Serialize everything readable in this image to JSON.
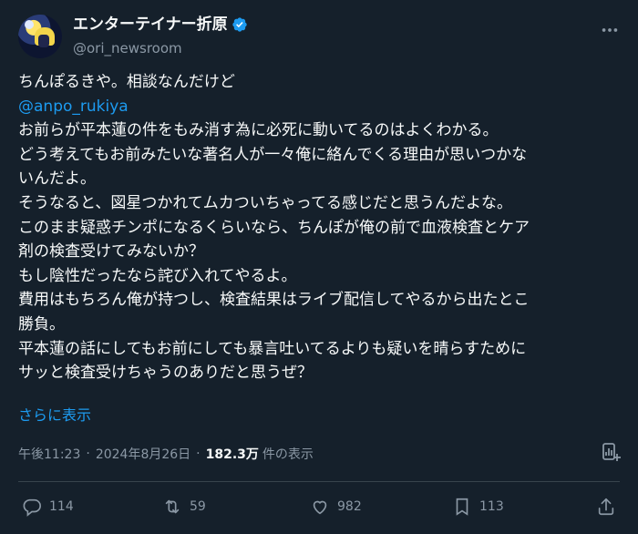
{
  "author": {
    "display_name": "エンターテイナー折原",
    "handle": "@ori_newsroom"
  },
  "tweet": {
    "lines": [
      "ちんぽるきや。相談なんだけど",
      "@anpo_rukiya",
      "お前らが平本蓮の件をもみ消す為に必死に動いてるのはよくわかる。",
      "どう考えてもお前みたいな著名人が一々俺に絡んでくる理由が思いつかな",
      "いんだよ。",
      "そうなると、図星つかれてムカついちゃってる感じだと思うんだよな。",
      "このまま疑惑チンポになるくらいなら、ちんぽが俺の前で血液検査とケア",
      "剤の検査受けてみないか？",
      "もし陰性だったなら詫び入れてやるよ。",
      "費用はもちろん俺が持つし、検査結果はライブ配信してやるから出たとこ",
      "勝負。",
      "平本蓮の話にしてもお前にしても暴言吐いてるよりも疑いを晴らすために",
      "サッと検査受けちゃうのありだと思うぜ？"
    ],
    "show_more": "さらに表示"
  },
  "meta": {
    "time": "午後11:23",
    "separator": "·",
    "date": "2024年8月26日",
    "views_count": "182.3万",
    "views_label": "件の表示"
  },
  "actions": {
    "reply_count": "114",
    "retweet_count": "59",
    "like_count": "982",
    "bookmark_count": "113"
  },
  "colors": {
    "background": "#15202b",
    "text": "#f7f9f9",
    "secondary": "#8b98a5",
    "accent": "#1d9bf0"
  }
}
